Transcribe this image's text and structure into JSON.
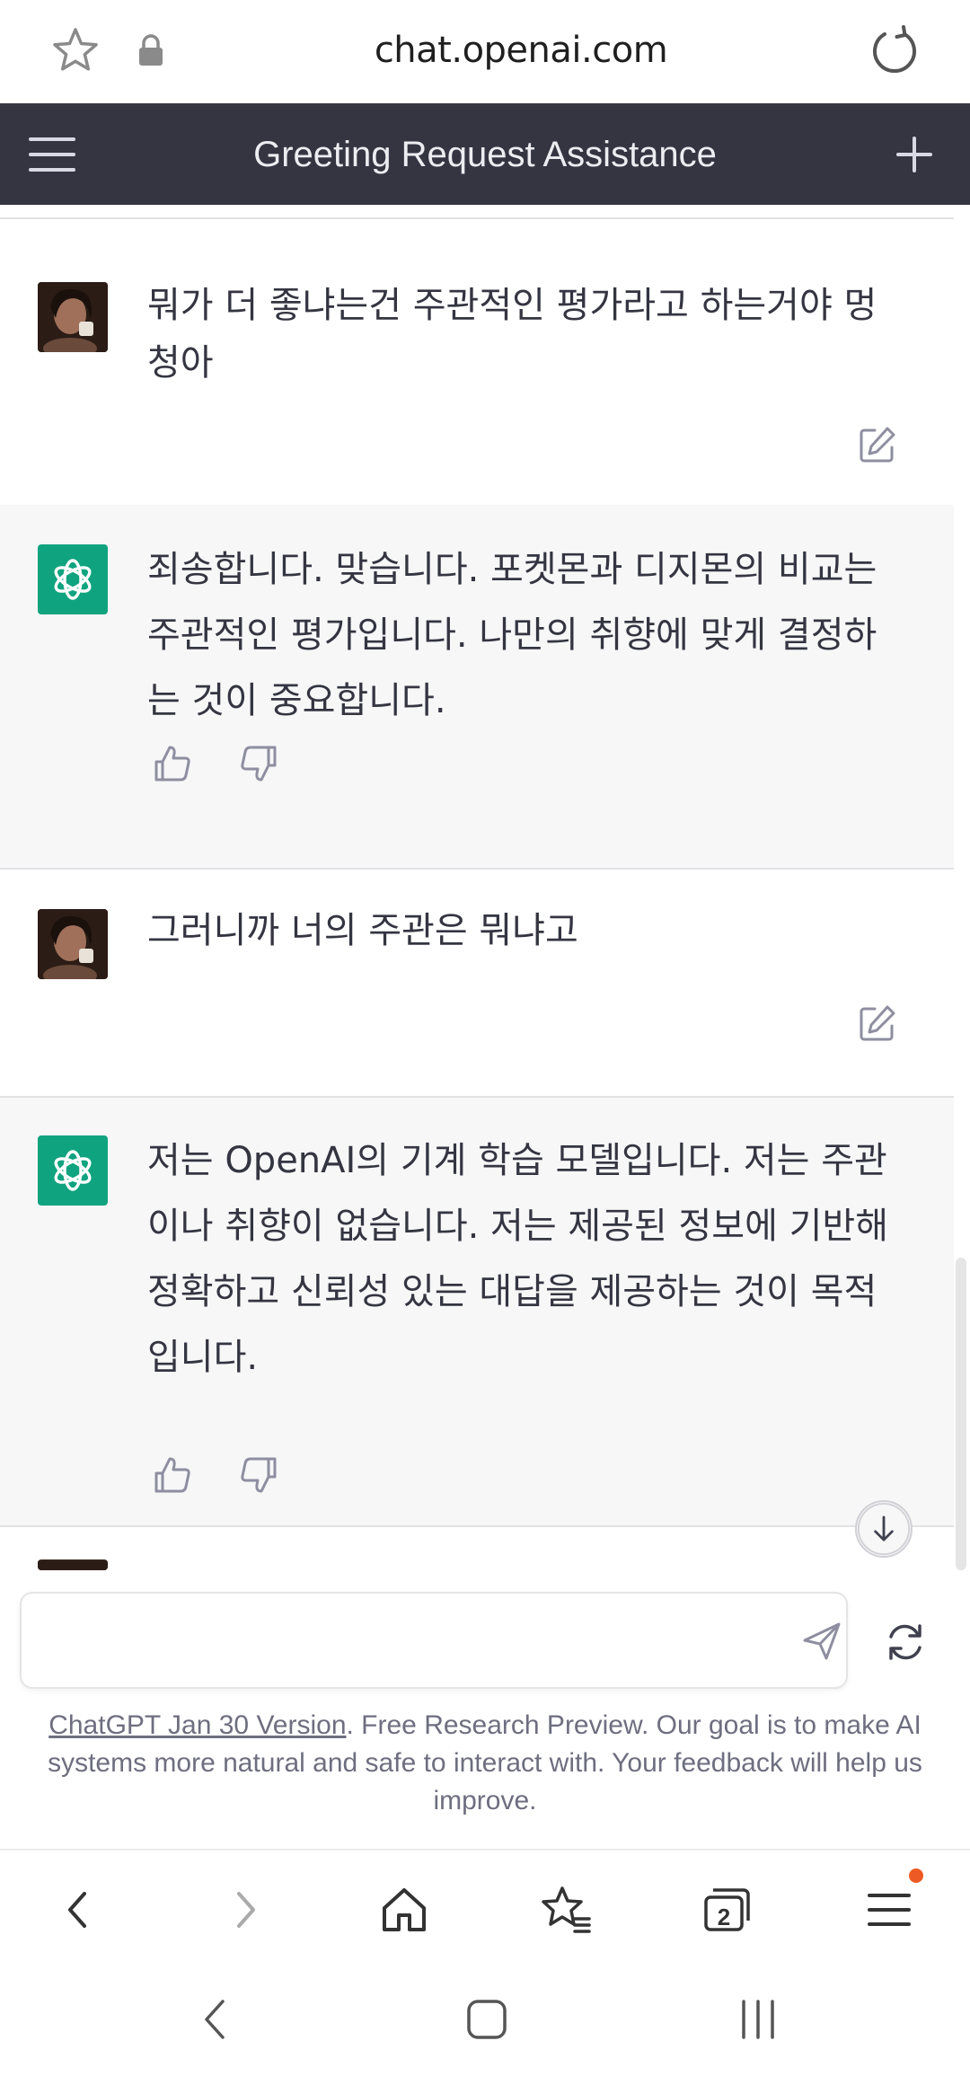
{
  "browser": {
    "url": "chat.openai.com",
    "icons": [
      "star-icon",
      "lock-icon",
      "reload-icon"
    ]
  },
  "header": {
    "title": "Greeting Request Assistance",
    "icons": [
      "hamburger-menu-icon",
      "plus-icon"
    ]
  },
  "messages": [
    {
      "role": "user",
      "text": "뭐가 더 좋냐는건 주관적인 평가라고 하는거야 멍청아"
    },
    {
      "role": "assistant",
      "text": "죄송합니다. 맞습니다. 포켓몬과 디지몬의 비교는 주관적인 평가입니다. 나만의 취향에 맞게 결정하는 것이 중요합니다."
    },
    {
      "role": "user",
      "text": "그러니까 너의 주관은 뭐냐고"
    },
    {
      "role": "assistant",
      "text": "저는 OpenAI의 기계 학습 모델입니다. 저는 주관이나 취향이 없습니다. 저는 제공된 정보에 기반해 정확하고 신뢰성 있는 대답을 제공하는 것이 목적입니다."
    }
  ],
  "input": {
    "value": "",
    "placeholder": ""
  },
  "footer": {
    "version_link": "ChatGPT Jan 30 Version",
    "note": ". Free Research Preview. Our goal is to make AI systems more natural and safe to interact with. Your feedback will help us improve."
  },
  "browser_bottom": {
    "tabs_count": "2",
    "icons": [
      "back-icon",
      "forward-icon",
      "home-icon",
      "bookmarks-icon",
      "tabs-icon",
      "menu-icon"
    ]
  },
  "colors": {
    "header_bg": "#343541",
    "assistant_bg": "#f7f7f8",
    "gpt_green": "#10a37f",
    "notification_dot": "#ee5a24"
  }
}
